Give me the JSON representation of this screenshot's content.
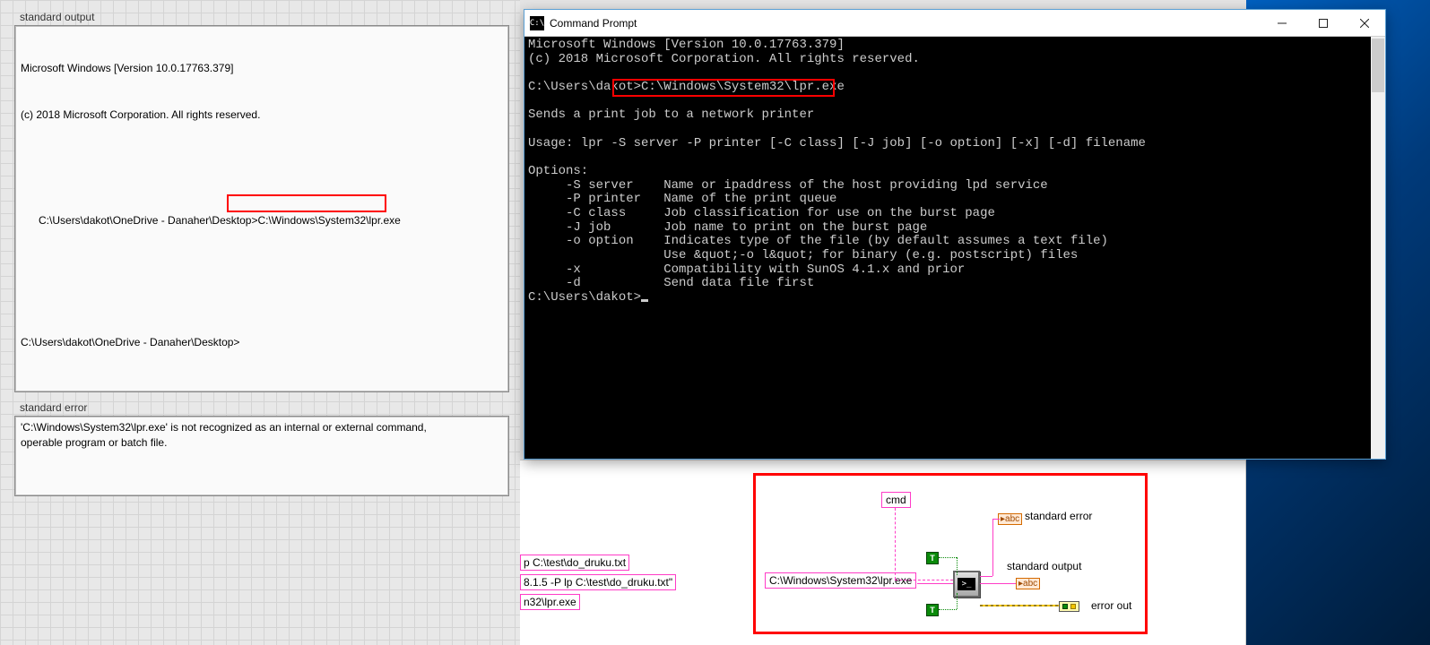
{
  "left": {
    "stdout_label": "standard output",
    "stdout_lines": {
      "l1": "Microsoft Windows [Version 10.0.17763.379]",
      "l2": "(c) 2018 Microsoft Corporation. All rights reserved.",
      "prompt1_prefix": "C:\\Users\\dakot\\OneDrive - Danaher\\Desktop>",
      "prompt1_cmd": "C:\\Windows\\System32\\lpr.exe",
      "prompt2": "C:\\Users\\dakot\\OneDrive - Danaher\\Desktop>"
    },
    "stderr_label": "standard error",
    "stderr_text": "'C:\\Windows\\System32\\lpr.exe' is not recognized as an internal or external command,\noperable program or batch file."
  },
  "cmd": {
    "title": "Command Prompt",
    "body_parts": {
      "l1": "Microsoft Windows [Version 10.0.17763.379]",
      "l2": "(c) 2018 Microsoft Corporation. All rights reserved.",
      "p1_prefix": "C:\\Users\\dako",
      "p1_boxed": "t>C:\\Windows\\System32\\lpr.exe",
      "desc": "Sends a print job to a network printer",
      "usage": "Usage: lpr -S server -P printer [-C class] [-J job] [-o option] [-x] [-d] filename",
      "opts_hdr": "Options:",
      "o1": "     -S server    Name or ipaddress of the host providing lpd service",
      "o2": "     -P printer   Name of the print queue",
      "o3": "     -C class     Job classification for use on the burst page",
      "o4": "     -J job       Job name to print on the burst page",
      "o5": "     -o option    Indicates type of the file (by default assumes a text file)",
      "o6": "                  Use &quot;-o l&quot; for binary (e.g. postscript) files",
      "o7": "     -x           Compatibility with SunOS 4.1.x and prior",
      "o8": "     -d           Send data file first",
      "p2": "C:\\Users\\dakot>"
    }
  },
  "snippets": {
    "s1": "p C:\\test\\do_druku.txt",
    "s2": "8.1.5 -P lp C:\\test\\do_druku.txt\"",
    "s3": "n32\\lpr.exe"
  },
  "diagram": {
    "cmd_label": "cmd",
    "input_str": "C:\\Windows\\System32\\lpr.exe",
    "std_err_label": "standard error",
    "std_out_label": "standard output",
    "err_out_label": "error out",
    "abc": "abc"
  }
}
